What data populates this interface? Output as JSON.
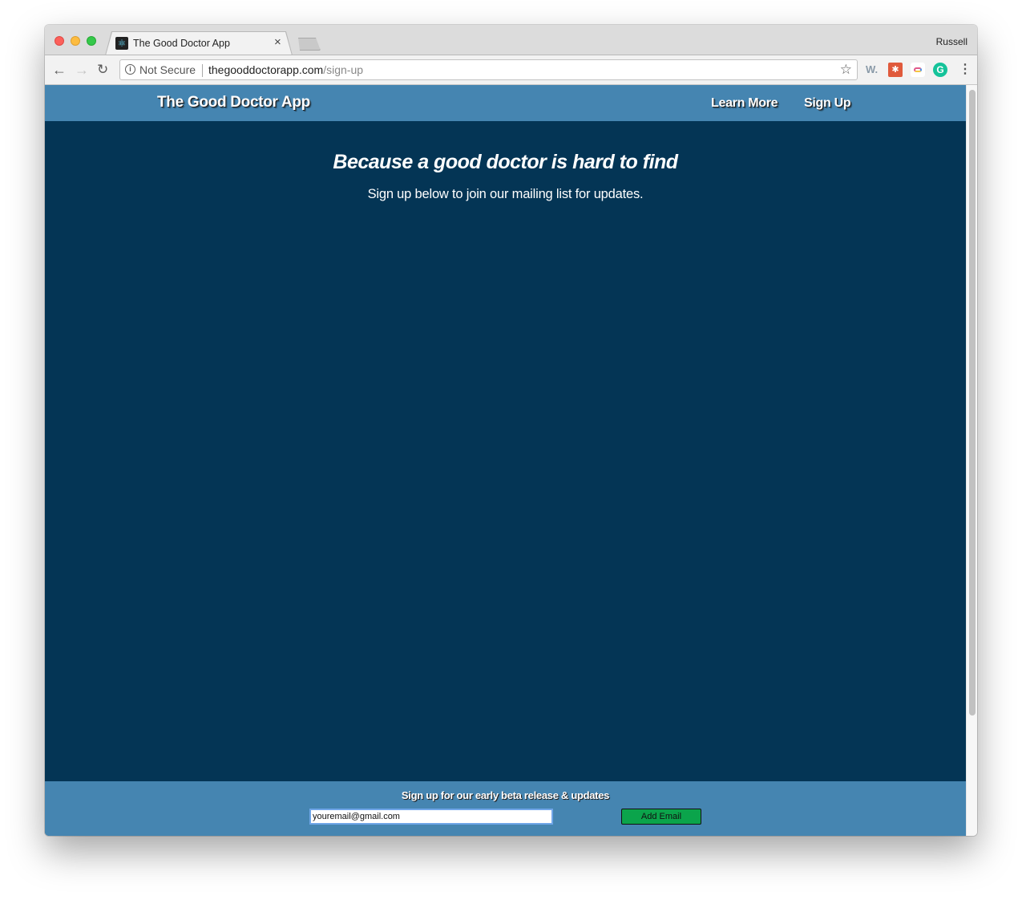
{
  "browser": {
    "tab": {
      "title": "The Good Doctor App",
      "favicon": "react-atom-icon",
      "close_glyph": "×"
    },
    "profile_name": "Russell",
    "toolbar": {
      "back_glyph": "←",
      "forward_glyph": "→",
      "reload_glyph": "↻",
      "security_label": "Not Secure",
      "info_glyph": "i",
      "url_domain": "thegooddoctorapp.com",
      "url_path": "/sign-up",
      "star_glyph": "☆",
      "menu_glyph": "⋮"
    },
    "extensions": [
      {
        "name": "w-extension",
        "glyph": "W."
      },
      {
        "name": "bug-extension",
        "glyph": "✱"
      },
      {
        "name": "link-extension",
        "glyph": ""
      },
      {
        "name": "grammarly-extension",
        "glyph": "G"
      }
    ]
  },
  "site": {
    "brand": "The Good Doctor App",
    "nav": [
      {
        "label": "Learn More"
      },
      {
        "label": "Sign Up"
      }
    ],
    "hero": {
      "title": "Because a good doctor is hard to find",
      "subtitle": "Sign up below to join our mailing list for updates."
    },
    "footer": {
      "title": "Sign up for our early beta release & updates",
      "email_value": "youremail@gmail.com",
      "button_label": "Add Email"
    },
    "colors": {
      "header_bg": "#4585b1",
      "page_bg": "#043555",
      "button_bg": "#0ba44b"
    }
  }
}
